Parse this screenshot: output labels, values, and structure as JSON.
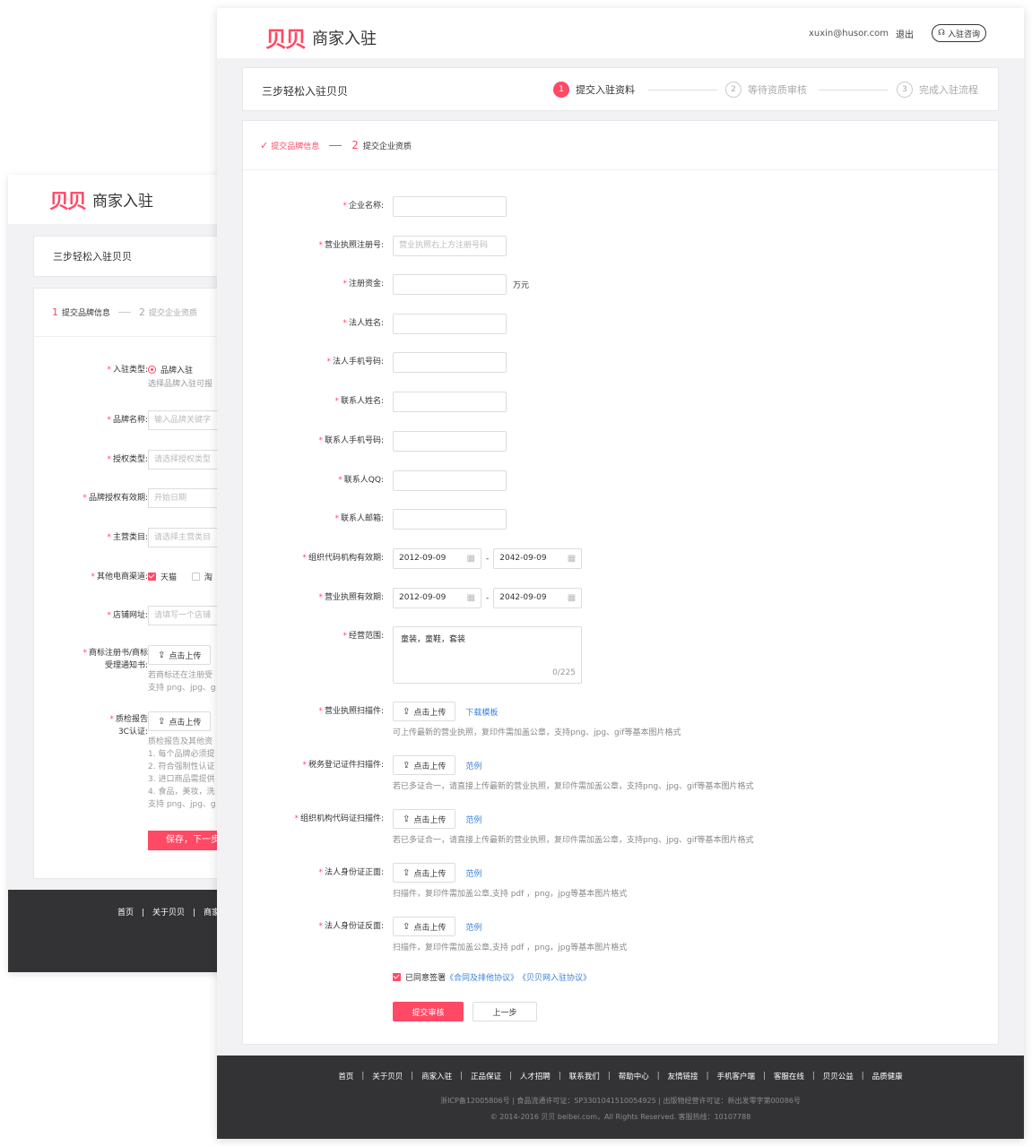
{
  "logo": {
    "mark": "贝贝",
    "text": "商家入驻"
  },
  "header": {
    "email": "xuxin@husor.com",
    "logout": "退出",
    "consult": "入驻咨询"
  },
  "steps": {
    "title": "三步轻松入驻贝贝",
    "items": [
      {
        "num": "1",
        "label": "提交入驻资料"
      },
      {
        "num": "2",
        "label": "等待资质审核"
      },
      {
        "num": "3",
        "label": "完成入驻流程"
      }
    ]
  },
  "back": {
    "subnav": {
      "step1_num": "1",
      "step1": "提交品牌信息",
      "step2_num": "2",
      "step2": "提交企业资质"
    },
    "rows": {
      "type_label": "入驻类型:",
      "type_option": "品牌入驻",
      "type_hint": "选择品牌入驻可报",
      "brand_label": "品牌名称:",
      "brand_placeholder": "输入品牌关键字",
      "auth_label": "授权类型:",
      "auth_placeholder": "请选择授权类型",
      "valid_label": "品牌授权有效期:",
      "valid_placeholder": "开始日期",
      "category_label": "主营类目:",
      "category_placeholder": "请选择主营类目",
      "channel_label": "其他电商渠道:",
      "channel_tmall": "天猫",
      "channel_other": "淘",
      "shop_label": "店铺网址:",
      "shop_placeholder": "请填写一个店铺",
      "trademark_label_1": "商标注册书/商标",
      "trademark_label_2": "受理通知书:",
      "upload": "点击上传",
      "trademark_hint_1": "若商标还在注册受",
      "trademark_hint_2": "支持 png、jpg、g",
      "qc_label_1": "质检报告",
      "qc_label_2": "3C认证:",
      "qc_hint_1": "质检报告及其他资",
      "qc_hint_2": "1. 每个品牌必须提",
      "qc_hint_3": "2. 符合强制性认证",
      "qc_hint_4": "3. 进口商品需提供",
      "qc_hint_5": "4. 食品，美妆，洗",
      "qc_hint_6": "支持 png、jpg、g",
      "save": "保存，下一步"
    },
    "footer_links": "首页　|　关于贝贝　|　商家"
  },
  "front": {
    "subnav": {
      "step1": "提交品牌信息",
      "step2_num": "2",
      "step2": "提交企业资质"
    },
    "fields": [
      {
        "label": "企业名称:",
        "value": ""
      },
      {
        "label": "营业执照注册号:",
        "value": "营业执照右上方注册号码"
      },
      {
        "label": "注册资金:",
        "value": "",
        "unit": "万元"
      },
      {
        "label": "法人姓名:",
        "value": ""
      },
      {
        "label": "法人手机号码:",
        "value": ""
      },
      {
        "label": "联系人姓名:",
        "value": ""
      },
      {
        "label": "联系人手机号码:",
        "value": ""
      },
      {
        "label": "联系人QQ:",
        "value": ""
      },
      {
        "label": "联系人邮箱:",
        "value": ""
      }
    ],
    "dates": [
      {
        "label": "组织代码机构有效期:",
        "start": "2012-09-09",
        "end": "2042-09-09"
      },
      {
        "label": "营业执照有效期:",
        "start": "2012-09-09",
        "end": "2042-09-09"
      }
    ],
    "scope": {
      "label": "经营范围:",
      "value": "童装，童鞋，套装",
      "count": "0/225"
    },
    "uploads": [
      {
        "label": "营业执照扫描件:",
        "button": "点击上传",
        "link": "下载模板",
        "hint": "可上传最新的营业执照，复印件需加盖公章，支持png、jpg、gif等基本图片格式"
      },
      {
        "label": "税务登记证件扫描件:",
        "button": "点击上传",
        "link": "范例",
        "hint": "若已多证合一，请直接上传最新的营业执照，复印件需加盖公章，支持png、jpg、gif等基本图片格式"
      },
      {
        "label": "组织机构代码证扫描件:",
        "button": "点击上传",
        "link": "范例",
        "hint": "若已多证合一，请直接上传最新的营业执照，复印件需加盖公章，支持png、jpg、gif等基本图片格式"
      },
      {
        "label": "法人身份证正面:",
        "button": "点击上传",
        "link": "范例",
        "hint": "扫描件，复印件需加盖公章,支持 pdf ，png，jpg等基本图片格式"
      },
      {
        "label": "法人身份证反面:",
        "button": "点击上传",
        "link": "范例",
        "hint": "扫描件，复印件需加盖公章,支持 pdf ，png，jpg等基本图片格式"
      }
    ],
    "agreement": {
      "text": "已同意签署",
      "link1": "《合同及排他协议》",
      "link2": "《贝贝网入驻协议》"
    },
    "buttons": {
      "submit": "提交审核",
      "prev": "上一步"
    }
  },
  "footer": {
    "links": [
      "首页",
      "关于贝贝",
      "商家入驻",
      "正品保证",
      "人才招聘",
      "联系我们",
      "帮助中心",
      "友情链接",
      "手机客户端",
      "客服在线",
      "贝贝公益",
      "品质健康"
    ],
    "icp": "浙ICP备12005806号 | 食品流通许可证：SP3301041510054925 | 出版物经营许可证：新出发零字第00086号",
    "copyright": "© 2014-2016 贝贝 beibei.com，All Rights Reserved. 客服热线：10107788"
  },
  "colors": {
    "accent": "#ff4965",
    "link": "#3b82d9",
    "footer_bg": "#333336"
  }
}
